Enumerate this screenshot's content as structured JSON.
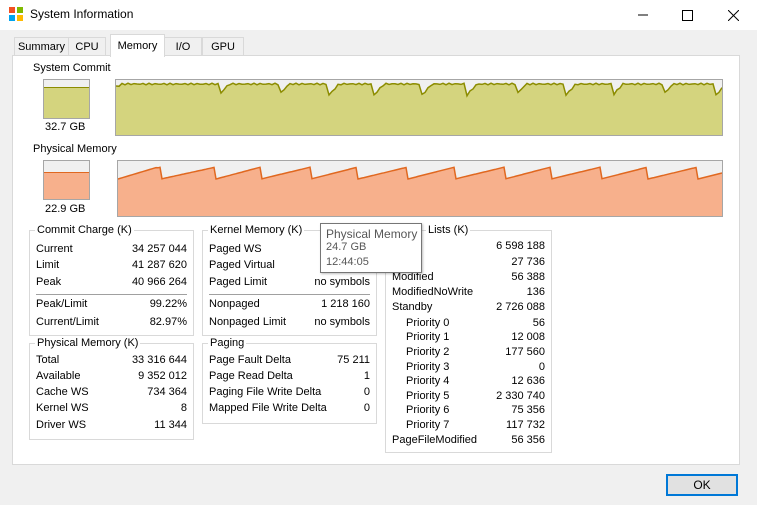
{
  "window": {
    "title": "System Information",
    "icon": "system-info-icon",
    "controls": {
      "minimize": "minimize-icon",
      "maximize": "maximize-icon",
      "close": "close-icon"
    }
  },
  "tabs": [
    {
      "label": "Summary"
    },
    {
      "label": "CPU"
    },
    {
      "label": "Memory",
      "active": true
    },
    {
      "label": "I/O"
    },
    {
      "label": "GPU"
    }
  ],
  "graphs": {
    "system_commit": {
      "label": "System Commit",
      "value": "32.7 GB",
      "fill_fraction": 0.79,
      "color": "#d4d47e",
      "line": "#8c8c00"
    },
    "physical_memory": {
      "label": "Physical Memory",
      "value": "22.9 GB",
      "fill_fraction": 0.69,
      "color": "#f7b08c",
      "line": "#e06820"
    }
  },
  "commit_charge": {
    "title": "Commit Charge (K)",
    "rows": [
      {
        "k": "Current",
        "v": "34 257 044"
      },
      {
        "k": "Limit",
        "v": "41 287 620"
      },
      {
        "k": "Peak",
        "v": "40 966 264"
      }
    ],
    "rows2": [
      {
        "k": "Peak/Limit",
        "v": "99.22%"
      },
      {
        "k": "Current/Limit",
        "v": "82.97%"
      }
    ]
  },
  "physical_memory": {
    "title": "Physical Memory (K)",
    "rows": [
      {
        "k": "Total",
        "v": "33 316 644"
      },
      {
        "k": "Available",
        "v": "9 352 012"
      },
      {
        "k": "Cache WS",
        "v": "734 364"
      },
      {
        "k": "Kernel WS",
        "v": "8"
      },
      {
        "k": "Driver WS",
        "v": "11 344"
      }
    ]
  },
  "kernel_memory": {
    "title": "Kernel Memory (K)",
    "rows": [
      {
        "k": "Paged WS",
        "v": ""
      },
      {
        "k": "Paged Virtual",
        "v": ""
      },
      {
        "k": "Paged Limit",
        "v": "no symbols"
      }
    ],
    "rows2": [
      {
        "k": "Nonpaged",
        "v": "1 218 160"
      },
      {
        "k": "Nonpaged Limit",
        "v": "no symbols"
      }
    ]
  },
  "paging": {
    "title": "Paging",
    "rows": [
      {
        "k": "Page Fault Delta",
        "v": "75 211"
      },
      {
        "k": "Page Read Delta",
        "v": "1"
      },
      {
        "k": "Paging File Write Delta",
        "v": "0"
      },
      {
        "k": "Mapped File Write Delta",
        "v": "0"
      }
    ]
  },
  "lists": {
    "title": "Lists (K)",
    "rows": [
      {
        "k": "d",
        "v": "6 598 188",
        "indent": false
      },
      {
        "k": "",
        "v": "27 736",
        "indent": false
      },
      {
        "k": "Modified",
        "v": "56 388",
        "indent": false
      },
      {
        "k": "ModifiedNoWrite",
        "v": "136",
        "indent": false
      },
      {
        "k": "Standby",
        "v": "2 726 088",
        "indent": false
      },
      {
        "k": "Priority 0",
        "v": "56",
        "indent": true
      },
      {
        "k": "Priority 1",
        "v": "12 008",
        "indent": true
      },
      {
        "k": "Priority 2",
        "v": "177 560",
        "indent": true
      },
      {
        "k": "Priority 3",
        "v": "0",
        "indent": true
      },
      {
        "k": "Priority 4",
        "v": "12 636",
        "indent": true
      },
      {
        "k": "Priority 5",
        "v": "2 330 740",
        "indent": true
      },
      {
        "k": "Priority 6",
        "v": "75 356",
        "indent": true
      },
      {
        "k": "Priority 7",
        "v": "117 732",
        "indent": true
      },
      {
        "k": "PageFileModified",
        "v": "56 356",
        "indent": false
      }
    ]
  },
  "tooltip": {
    "title": "Physical Memory",
    "value": "24.7 GB",
    "time": "12:44:05"
  },
  "ok_label": "OK"
}
